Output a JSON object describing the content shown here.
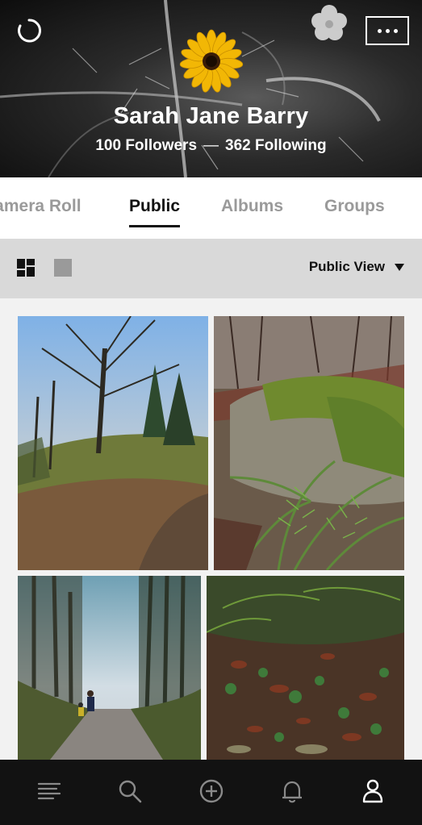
{
  "header": {
    "name": "Sarah Jane Barry",
    "followers": "100 Followers",
    "separator": "—",
    "following": "362 Following"
  },
  "tabs": [
    {
      "label": "Camera Roll",
      "active": false
    },
    {
      "label": "Public",
      "active": true
    },
    {
      "label": "Albums",
      "active": false
    },
    {
      "label": "Groups",
      "active": false
    }
  ],
  "viewbar": {
    "view_label": "Public View"
  },
  "photos": [
    {
      "subject": "bare trees on mossy forest hill"
    },
    {
      "subject": "mossy boulder with ferns"
    },
    {
      "subject": "forest path with two hikers"
    },
    {
      "subject": "forest floor with ivy and leaves"
    }
  ],
  "bottom_nav": [
    {
      "icon": "menu-icon",
      "active": false
    },
    {
      "icon": "search-icon",
      "active": false
    },
    {
      "icon": "add-icon",
      "active": false
    },
    {
      "icon": "bell-icon",
      "active": false
    },
    {
      "icon": "profile-icon",
      "active": true
    }
  ],
  "colors": {
    "header_bg": "#1a1a1a",
    "accent_flower": "#f2b705",
    "active_text": "#111111",
    "inactive_text": "#9a9a9a",
    "nav_bg": "#121212"
  }
}
